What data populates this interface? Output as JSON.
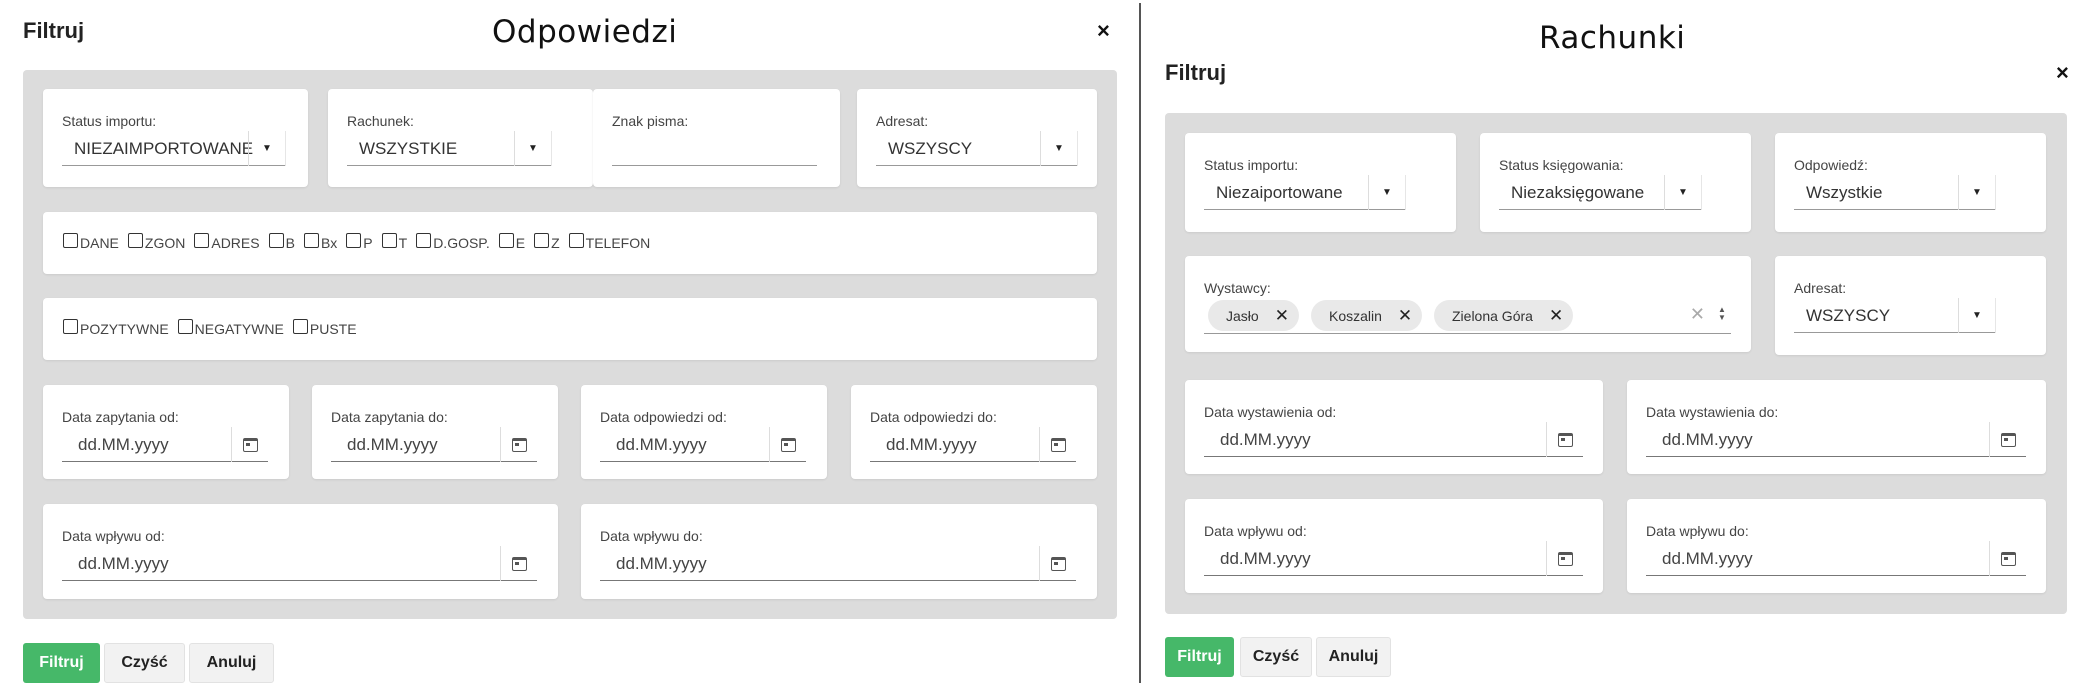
{
  "left": {
    "filter_heading": "Filtruj",
    "title": "Odpowiedzi",
    "close": "×",
    "status_importu": {
      "label": "Status importu:",
      "value": "NIEZAIMPORTOWANE"
    },
    "rachunek": {
      "label": "Rachunek:",
      "value": "WSZYSTKIE"
    },
    "znak_pisma": {
      "label": "Znak pisma:",
      "value": ""
    },
    "adresat": {
      "label": "Adresat:",
      "value": "WSZYSCY"
    },
    "checkboxes_row1": [
      "DANE",
      "ZGON",
      "ADRES",
      "B",
      "Bx",
      "P",
      "T",
      "D.GOSP.",
      "E",
      "Z",
      "TELEFON"
    ],
    "checkboxes_row2": [
      "POZYTYWNE",
      "NEGATYWNE",
      "PUSTE"
    ],
    "date_fields": [
      {
        "label": "Data zapytania od:",
        "placeholder": "dd.MM.yyyy"
      },
      {
        "label": "Data zapytania do:",
        "placeholder": "dd.MM.yyyy"
      },
      {
        "label": "Data odpowiedzi od:",
        "placeholder": "dd.MM.yyyy"
      },
      {
        "label": "Data odpowiedzi do:",
        "placeholder": "dd.MM.yyyy"
      },
      {
        "label": "Data wpływu od:",
        "placeholder": "dd.MM.yyyy"
      },
      {
        "label": "Data wpływu do:",
        "placeholder": "dd.MM.yyyy"
      }
    ],
    "buttons": {
      "filter": "Filtruj",
      "clear": "Czyść",
      "cancel": "Anuluj"
    }
  },
  "right": {
    "title": "Rachunki",
    "filter_heading": "Filtruj",
    "close": "×",
    "status_importu": {
      "label": "Status importu:",
      "value": "Niezaiportowane"
    },
    "status_ksiegowania": {
      "label": "Status księgowania:",
      "value": "Niezaksięgowane"
    },
    "odpowiedz": {
      "label": "Odpowiedź:",
      "value": "Wszystkie"
    },
    "wystawcy": {
      "label": "Wystawcy:",
      "chips": [
        "Jasło",
        "Koszalin",
        "Zielona Góra"
      ]
    },
    "adresat": {
      "label": "Adresat:",
      "value": "WSZYSCY"
    },
    "date_fields": [
      {
        "label": "Data wystawienia od:",
        "placeholder": "dd.MM.yyyy"
      },
      {
        "label": "Data wystawienia do:",
        "placeholder": "dd.MM.yyyy"
      },
      {
        "label": "Data wpływu od:",
        "placeholder": "dd.MM.yyyy"
      },
      {
        "label": "Data wpływu do:",
        "placeholder": "dd.MM.yyyy"
      }
    ],
    "buttons": {
      "filter": "Filtruj",
      "clear": "Czyść",
      "cancel": "Anuluj"
    }
  },
  "icons": {
    "close": "close-icon",
    "dropdown": "caret-down-icon",
    "calendar": "calendar-icon",
    "chip_remove": "chip-remove-icon",
    "clear": "clear-icon",
    "spinner": "spinner-icon"
  },
  "colors": {
    "primary_button": "#46b869",
    "panel_background": "#dcdcdc",
    "divider": "#555555"
  }
}
